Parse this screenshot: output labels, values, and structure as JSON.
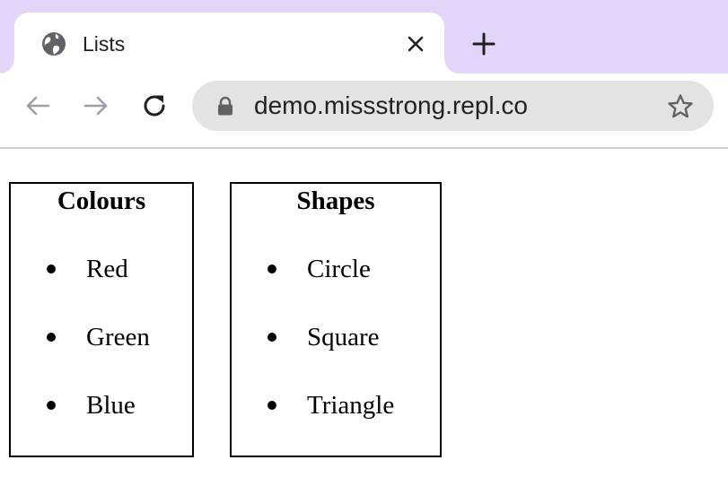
{
  "browser": {
    "tab": {
      "title": "Lists",
      "favicon_icon": "globe-icon",
      "close_icon": "close-icon"
    },
    "new_tab_icon": "plus-icon",
    "toolbar": {
      "back_icon": "arrow-left-icon",
      "forward_icon": "arrow-right-icon",
      "reload_icon": "reload-icon"
    },
    "address_bar": {
      "url": "demo.missstrong.repl.co",
      "lock_icon": "lock-icon",
      "bookmark_icon": "star-icon"
    },
    "colors": {
      "tabstrip": "#e3d5fa",
      "omnibox": "#e3e3e3",
      "icon": "#5f6368"
    }
  },
  "page": {
    "lists": [
      {
        "heading": "Colours",
        "items": [
          "Red",
          "Green",
          "Blue"
        ]
      },
      {
        "heading": "Shapes",
        "items": [
          "Circle",
          "Square",
          "Triangle"
        ]
      }
    ]
  }
}
